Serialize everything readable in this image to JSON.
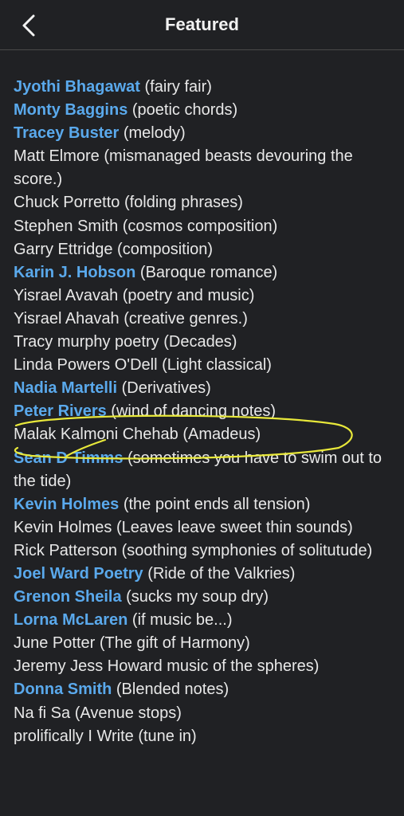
{
  "header": {
    "title": "Featured"
  },
  "colors": {
    "background": "#202124",
    "link": "#5aa9ec",
    "text": "#e8e8e8",
    "highlight_annotation": "#e8e83a"
  },
  "entries": [
    {
      "name": "Jyothi Bhagawat",
      "desc": " (fairy fair)",
      "link": true
    },
    {
      "name": "Monty Baggins",
      "desc": "  (poetic chords)",
      "link": true
    },
    {
      "name": "Tracey Buster",
      "desc": "  (melody)",
      "link": true
    },
    {
      "name": "Matt Elmore",
      "desc": " (mismanaged beasts devouring the score.)",
      "link": false
    },
    {
      "name": "Chuck Porretto",
      "desc": " (folding phrases)",
      "link": false
    },
    {
      "name": "Stephen Smith",
      "desc": " (cosmos composition)",
      "link": false
    },
    {
      "name": "Garry Ettridge",
      "desc": " (composition)",
      "link": false
    },
    {
      "name": "Karin J. Hobson",
      "desc": "  (Baroque romance)",
      "link": true
    },
    {
      "name": "Yisrael Avavah",
      "desc": " (poetry and music)",
      "link": false
    },
    {
      "name": "Yisrael Ahavah",
      "desc": " (creative genres.)",
      "link": false
    },
    {
      "name": "Tracy murphy poetry",
      "desc": " (Decades)",
      "link": false
    },
    {
      "name": "Linda Powers O'Dell",
      "desc": " (Light classical)",
      "link": false
    },
    {
      "name": "Nadia Martelli",
      "desc": "  (Derivatives)",
      "link": true
    },
    {
      "name": "Peter Rivers",
      "desc": "  (wind of dancing notes)",
      "link": true
    },
    {
      "name": "Malak Kalmoni Chehab",
      "desc": " (Amadeus)",
      "link": false
    },
    {
      "name": "Sean D Timms",
      "desc": "  (sometimes you have to swim out to the tide)",
      "link": true
    },
    {
      "name": "Kevin Holmes",
      "desc": "  (the point ends all tension)",
      "link": true
    },
    {
      "name": "Kevin Holmes",
      "desc": " (Leaves leave sweet thin sounds)",
      "link": false
    },
    {
      "name": "Rick Patterson",
      "desc": " (soothing symphonies of solitutude)",
      "link": false
    },
    {
      "name": "Joel Ward Poetry",
      "desc": "  (Ride of the Valkries)",
      "link": true
    },
    {
      "name": "Grenon Sheila",
      "desc": "  (sucks my soup dry)",
      "link": true
    },
    {
      "name": "Lorna McLaren",
      "desc": "  (if music be...)",
      "link": true
    },
    {
      "name": "June Potter",
      "desc": " (The gift of Harmony)",
      "link": false
    },
    {
      "name": "Jeremy Jess Howard",
      "desc": " music of the spheres)",
      "link": false
    },
    {
      "name": "Donna Smith",
      "desc": " (Blended notes)",
      "link": true
    },
    {
      "name": "Na fi Sa",
      "desc": " (Avenue stops)",
      "link": false
    },
    {
      "name": " prolifically I Write",
      "desc": "  (tune in)",
      "link": false
    }
  ]
}
